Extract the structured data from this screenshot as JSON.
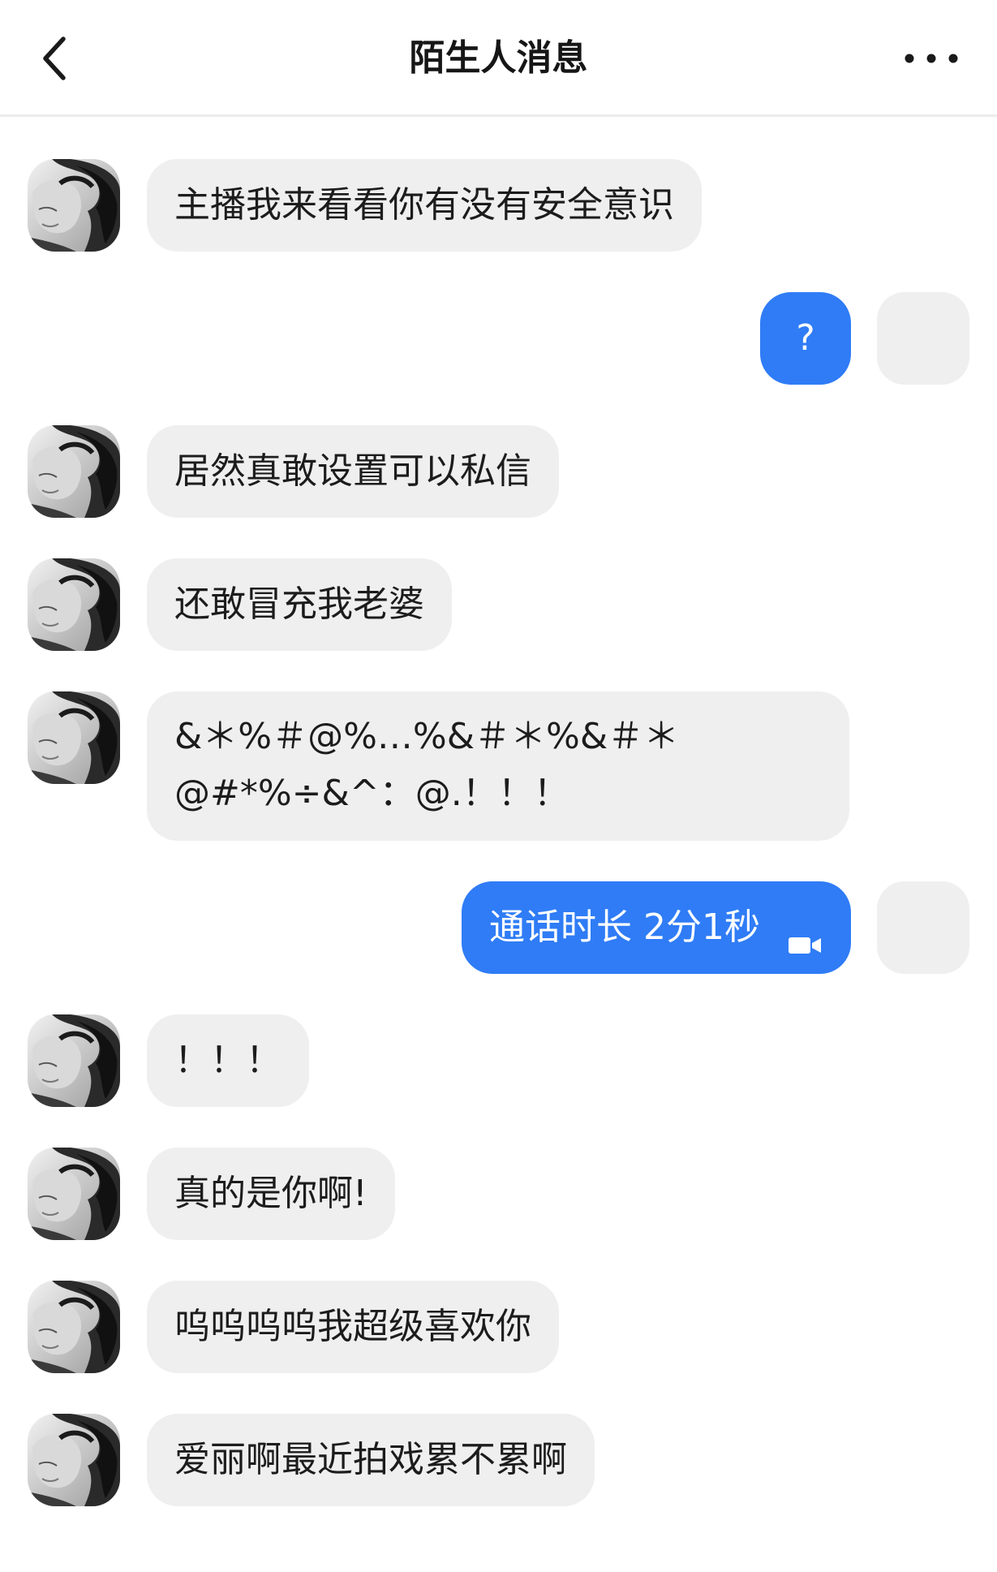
{
  "header": {
    "title": "陌生人消息",
    "back_icon": "chevron-left-icon",
    "more_icon": "more-horizontal-icon"
  },
  "messages": [
    {
      "from": "other",
      "text": "主播我来看看你有没有安全意识"
    },
    {
      "from": "me",
      "text": "?"
    },
    {
      "from": "other",
      "text": "居然真敢设置可以私信"
    },
    {
      "from": "other",
      "text": "还敢冒充我老婆"
    },
    {
      "from": "other",
      "lines": [
        "&＊%＃@%…%&＃＊%&＃＊",
        "@#*%÷&^：@.！！！"
      ]
    },
    {
      "from": "me",
      "text": "通话时长 2分1秒",
      "icon": "video-camera-icon"
    },
    {
      "from": "other",
      "text": "！！！"
    },
    {
      "from": "other",
      "text": "真的是你啊!"
    },
    {
      "from": "other",
      "text": "呜呜呜呜我超级喜欢你"
    },
    {
      "from": "other",
      "text": "爱丽啊最近拍戏累不累啊"
    }
  ],
  "colors": {
    "outgoing_bubble": "#2f7cf6",
    "incoming_bubble": "#efefef",
    "divider": "#ececec"
  }
}
